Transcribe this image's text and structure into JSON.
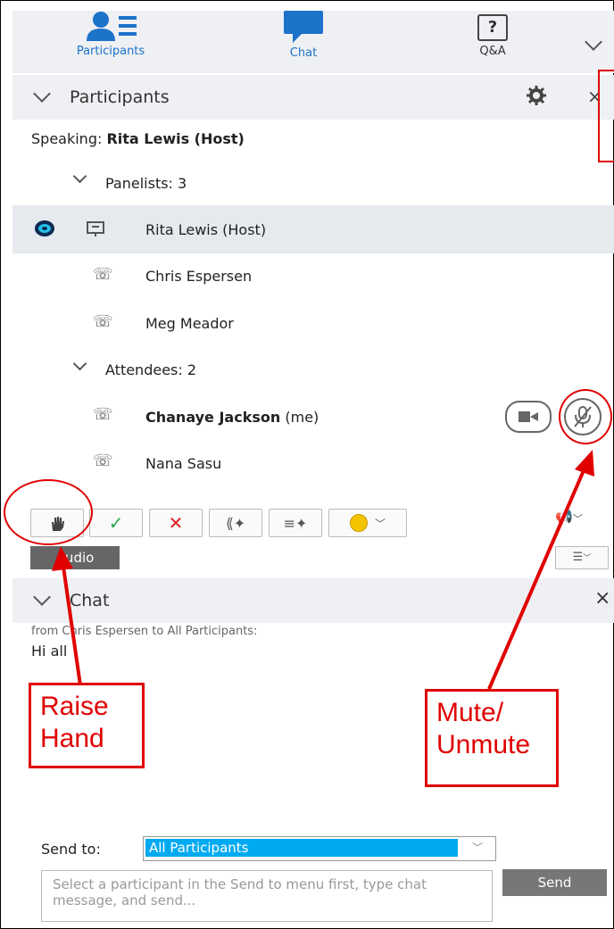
{
  "tabs": [
    {
      "label": "Participants",
      "icon": "participants-icon"
    },
    {
      "label": "Chat",
      "icon": "chat-bubble-icon"
    },
    {
      "label": "Q&A",
      "icon": "question-box-icon",
      "glyph": "?"
    }
  ],
  "participants_panel": {
    "title": "Participants",
    "speaking_prefix": "Speaking:",
    "speaking_name": "Rita Lewis (Host)",
    "panelists_label": "Panelists: 3",
    "panelists": [
      {
        "name": "Rita Lewis (Host)",
        "icon": "screen-icon"
      },
      {
        "name": "Chris Espersen",
        "icon": "phone-icon"
      },
      {
        "name": "Meg Meador",
        "icon": "phone-icon"
      }
    ],
    "attendees_label": "Attendees: 2",
    "attendees": [
      {
        "name": "Chanaye Jackson",
        "suffix": "(me)",
        "icon": "phone-icon"
      },
      {
        "name": "Nana Sasu",
        "icon": "phone-icon"
      }
    ]
  },
  "toolbar": {
    "audio_label": "Audio"
  },
  "chat_panel": {
    "title": "Chat",
    "message_from": "from Chris Espersen to All Participants:",
    "message_text": "Hi all",
    "send_to_label": "Send to:",
    "send_to_value": "All Participants",
    "input_placeholder": "Select a participant in the Send to menu first, type chat message, and send...",
    "send_button": "Send"
  },
  "annotations": {
    "raise_hand": "Raise Hand",
    "mute": "Mute/ Unmute"
  },
  "colors": {
    "accent": "#1d72c9",
    "highlight": "#00aaf0",
    "annotation_red": "#e00000"
  }
}
